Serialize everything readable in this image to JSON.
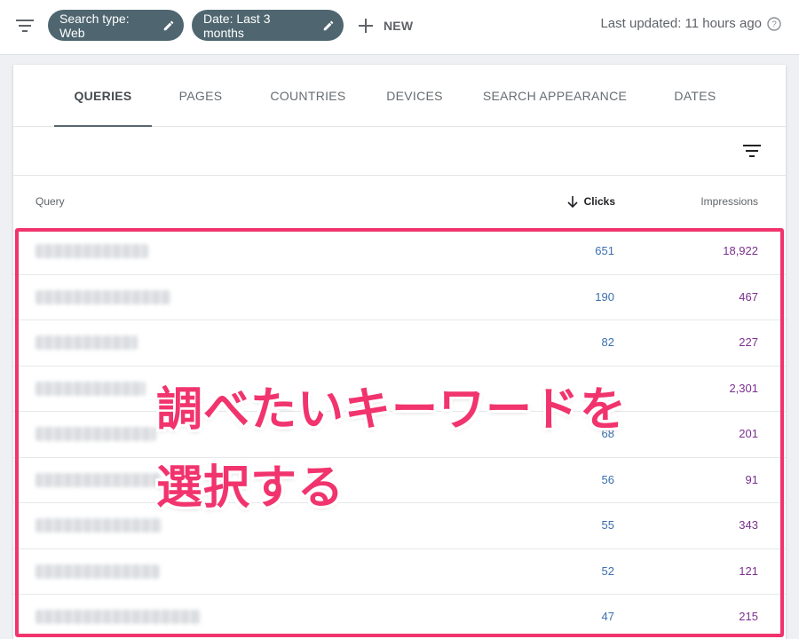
{
  "topbar": {
    "filter_icon": "filter-list-icon",
    "chips": [
      {
        "label": "Search type: Web",
        "icon": "pencil-icon"
      },
      {
        "label": "Date: Last 3 months",
        "icon": "pencil-icon"
      }
    ],
    "new_label": "NEW",
    "last_updated": "Last updated: 11 hours ago",
    "help_icon": "help-circle-icon"
  },
  "tabs": [
    {
      "label": "QUERIES",
      "active": true
    },
    {
      "label": "PAGES",
      "active": false
    },
    {
      "label": "COUNTRIES",
      "active": false
    },
    {
      "label": "DEVICES",
      "active": false
    },
    {
      "label": "SEARCH APPEARANCE",
      "active": false
    },
    {
      "label": "DATES",
      "active": false
    }
  ],
  "table": {
    "filter_icon": "filter-list-icon",
    "columns": {
      "query": "Query",
      "clicks": "Clicks",
      "impressions": "Impressions",
      "sort_icon": "arrow-down-icon"
    },
    "rows": [
      {
        "clicks": "651",
        "impressions": "18,922"
      },
      {
        "clicks": "190",
        "impressions": "467"
      },
      {
        "clicks": "82",
        "impressions": "227"
      },
      {
        "clicks": "",
        "impressions": "2,301"
      },
      {
        "clicks": "68",
        "impressions": "201"
      },
      {
        "clicks": "56",
        "impressions": "91"
      },
      {
        "clicks": "55",
        "impressions": "343"
      },
      {
        "clicks": "52",
        "impressions": "121"
      },
      {
        "clicks": "47",
        "impressions": "215"
      }
    ]
  },
  "annotation": {
    "line1": "調べたいキーワードを",
    "line2": "選択する",
    "color": "#f1346d"
  },
  "colors": {
    "chip_bg": "#4f6670",
    "clicks_text": "#3a6fb0",
    "impressions_text": "#7b2f8f",
    "highlight": "#f1346d"
  }
}
